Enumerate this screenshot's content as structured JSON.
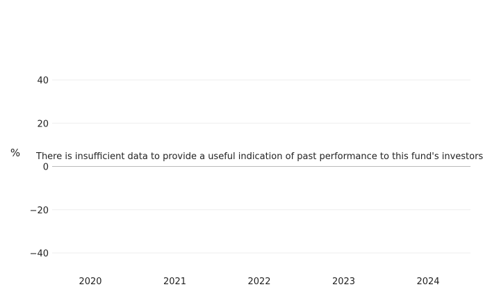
{
  "chart_data": {
    "type": "bar",
    "title": "",
    "xlabel": "",
    "ylabel": "%",
    "categories": [
      "2020",
      "2021",
      "2022",
      "2023",
      "2024"
    ],
    "series": [],
    "ylim": [
      -40,
      40
    ],
    "yticks": [
      40,
      20,
      0,
      -20,
      -40
    ],
    "ytick_labels": [
      "40",
      "20",
      "0",
      "−20",
      "−40"
    ],
    "grid": true,
    "legend": "none",
    "annotation": "There is insufficient data to provide a useful indication of past performance to this fund's investors.",
    "colors": {
      "grid": "#eeeeee",
      "zero_line": "#bbbbbb",
      "text": "#222222"
    }
  }
}
